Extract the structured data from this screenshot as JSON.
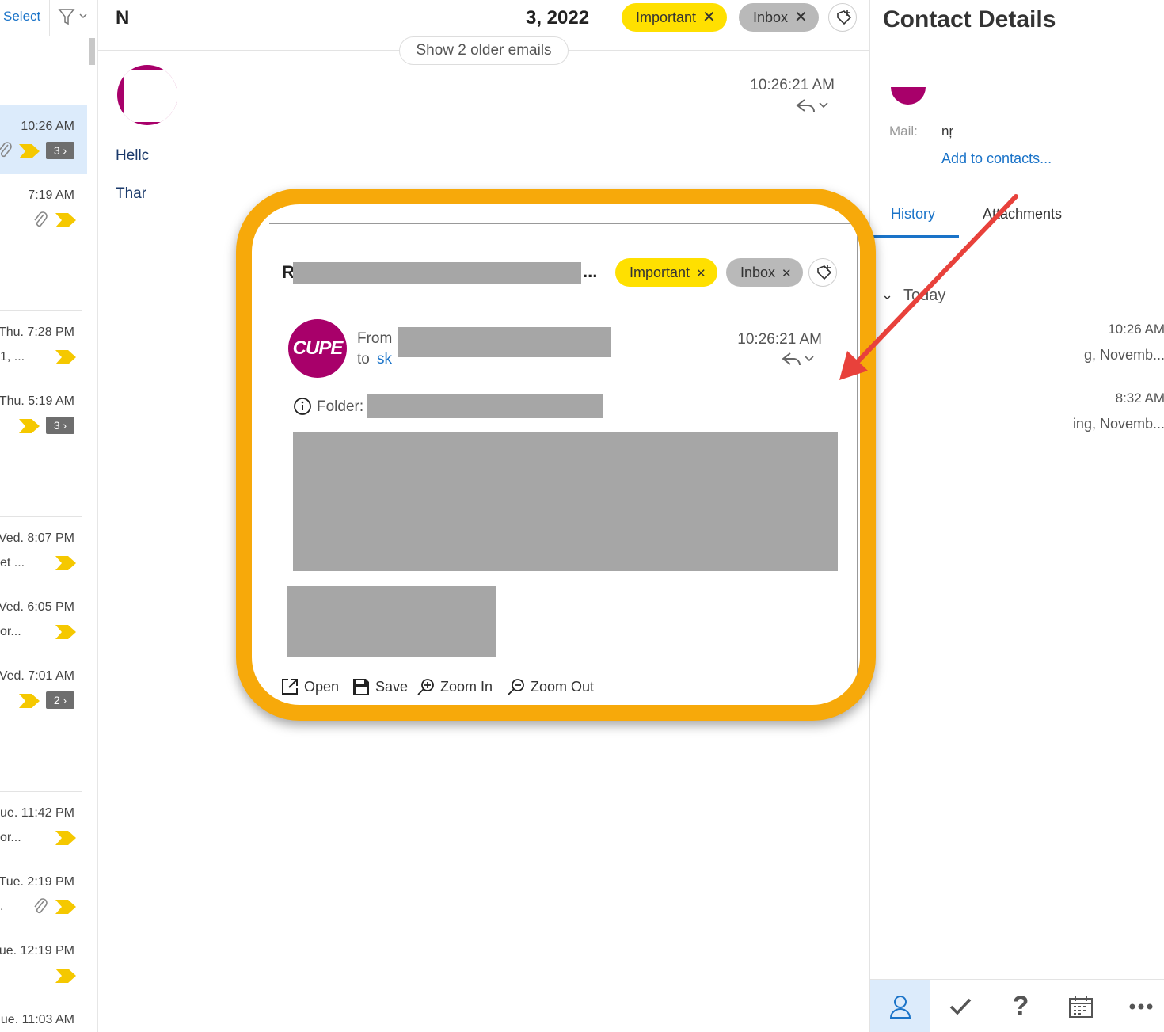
{
  "list": {
    "select_label": "Select",
    "items": [
      {
        "time": "10:26 AM",
        "snippet": "",
        "count": "3 ›"
      },
      {
        "time": "7:19 AM",
        "snippet": ""
      },
      {
        "time": "Thu. 7:28 PM",
        "snippet": "1, ..."
      },
      {
        "time": "Thu. 5:19 AM",
        "snippet": "",
        "count": "3 ›"
      },
      {
        "time": "Ved. 8:07 PM",
        "snippet": "et ..."
      },
      {
        "time": "Ved. 6:05 PM",
        "snippet": "or..."
      },
      {
        "time": "Ved. 7:01 AM",
        "snippet": "",
        "count": "2 ›"
      },
      {
        "time": "ue. 11:42 PM",
        "snippet": "or..."
      },
      {
        "time": "Tue. 2:19 PM",
        "snippet": "."
      },
      {
        "time": "ue. 12:19 PM",
        "snippet": ""
      },
      {
        "time": "ue. 11:03 AM",
        "snippet": ""
      }
    ]
  },
  "reading": {
    "subject_left": "N",
    "subject_right": "3, 2022",
    "chip_important": "Important",
    "chip_inbox": "Inbox",
    "older_label": "Show 2 older emails",
    "time": "10:26:21 AM",
    "body_hello": "Hellc",
    "body_thanks": "Thar"
  },
  "callout": {
    "subject_start": "R",
    "subject_ellipsis": "...",
    "chip_important": "Important",
    "chip_inbox": "Inbox",
    "logo_text": "CUPE",
    "from_label": "From",
    "to_label": "to",
    "to_name": "sk",
    "time": "10:26:21 AM",
    "folder_label": "Folder:",
    "tools": {
      "open": "Open",
      "save": "Save",
      "zoom_in": "Zoom In",
      "zoom_out": "Zoom Out"
    }
  },
  "contact": {
    "title": "Contact Details",
    "mail_label": "Mail:",
    "mail_value": "nŗ",
    "add_contacts": "Add to contacts...",
    "tab_history": "History",
    "tab_attachments": "Attachments",
    "today_label": "Today",
    "history": [
      {
        "time": "10:26 AM",
        "snippet": "g, Novemb..."
      },
      {
        "time": "8:32 AM",
        "snippet": "ing, Novemb..."
      }
    ]
  },
  "colors": {
    "accent": "#1a73c8",
    "important": "#ffe000",
    "callout_border": "#f7a90a",
    "avatar": "#a8006a",
    "arrow": "#e8413b"
  }
}
